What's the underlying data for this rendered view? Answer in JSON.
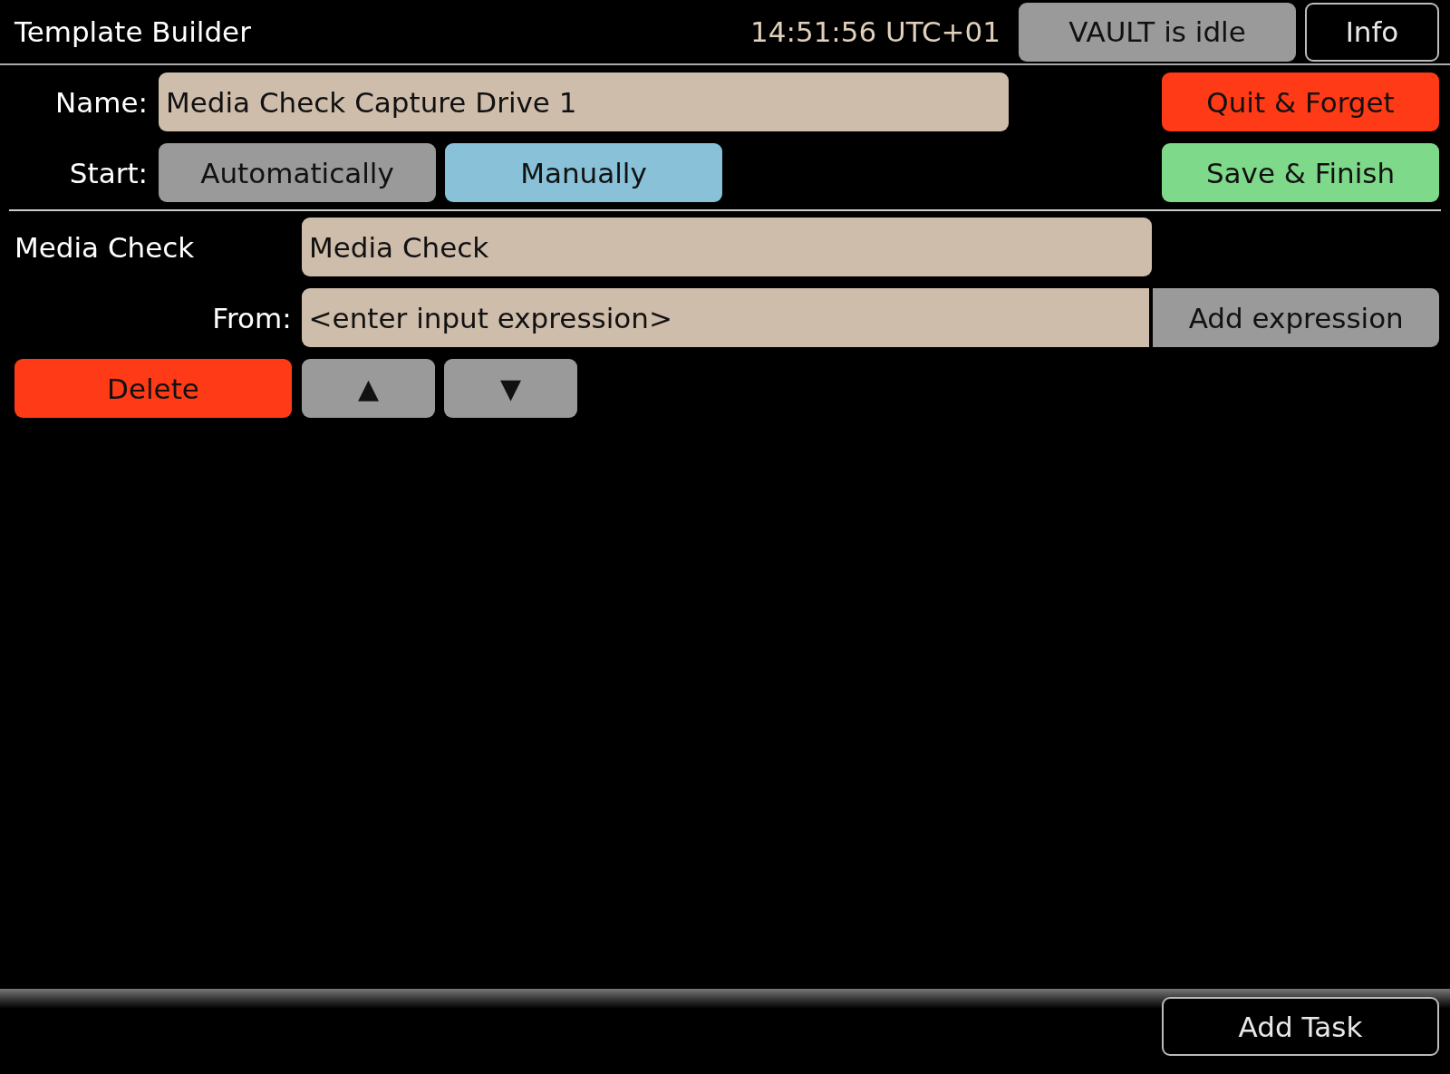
{
  "header": {
    "title": "Template Builder",
    "clock": "14:51:56 UTC+01",
    "status_button": "VAULT is idle",
    "info_button": "Info"
  },
  "name_row": {
    "label": "Name:",
    "value": "Media Check Capture Drive 1",
    "quit_button": "Quit & Forget"
  },
  "start_row": {
    "label": "Start:",
    "options": [
      {
        "label": "Automatically",
        "selected": false
      },
      {
        "label": "Manually",
        "selected": true
      }
    ],
    "save_button": "Save & Finish"
  },
  "task": {
    "label": "Media Check",
    "value": "Media Check",
    "from_label": "From:",
    "from_placeholder": "<enter input expression>",
    "add_expression_button": "Add expression",
    "delete_button": "Delete",
    "up_button": "▲",
    "down_button": "▼"
  },
  "footer": {
    "add_task_button": "Add Task"
  }
}
